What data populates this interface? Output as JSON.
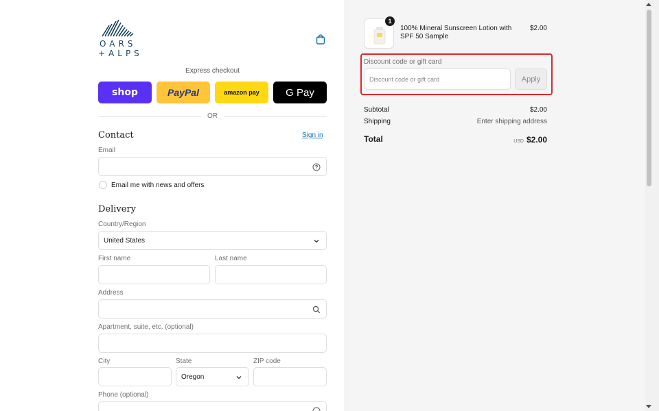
{
  "brand": {
    "line1": "OARS",
    "line2": "+ALPS"
  },
  "express": {
    "title": "Express checkout",
    "buttons": [
      {
        "label": "shop",
        "color": "#5a31f4"
      },
      {
        "label": "PayPal",
        "color": "#ffc439"
      },
      {
        "label": "amazon pay",
        "color": "#ffd814"
      },
      {
        "label": "G Pay",
        "color": "#000000"
      }
    ],
    "divider_text": "OR"
  },
  "contact": {
    "heading": "Contact",
    "sign_in": "Sign in",
    "email_label": "Email",
    "email_value": "",
    "newsletter_label": "Email me with news and offers"
  },
  "delivery": {
    "heading": "Delivery",
    "country_label": "Country/Region",
    "country_value": "United States",
    "first_name_label": "First name",
    "last_name_label": "Last name",
    "address_label": "Address",
    "apartment_label": "Apartment, suite, etc. (optional)",
    "city_label": "City",
    "state_label": "State",
    "state_value": "Oregon",
    "zip_label": "ZIP code",
    "phone_label": "Phone (optional)"
  },
  "summary": {
    "item": {
      "name": "100% Mineral Sunscreen Lotion with SPF 50 Sample",
      "price": "$2.00",
      "quantity": "1"
    },
    "discount": {
      "label": "Discount code or gift card",
      "placeholder": "Discount code or gift card",
      "apply_label": "Apply",
      "highlight_color": "#e0252b"
    },
    "subtotal_label": "Subtotal",
    "subtotal_value": "$2.00",
    "shipping_label": "Shipping",
    "shipping_value": "Enter shipping address",
    "total_label": "Total",
    "currency": "USD",
    "total_value": "$2.00"
  },
  "colors": {
    "link": "#1773b0",
    "right_bg": "#f5f5f5"
  }
}
